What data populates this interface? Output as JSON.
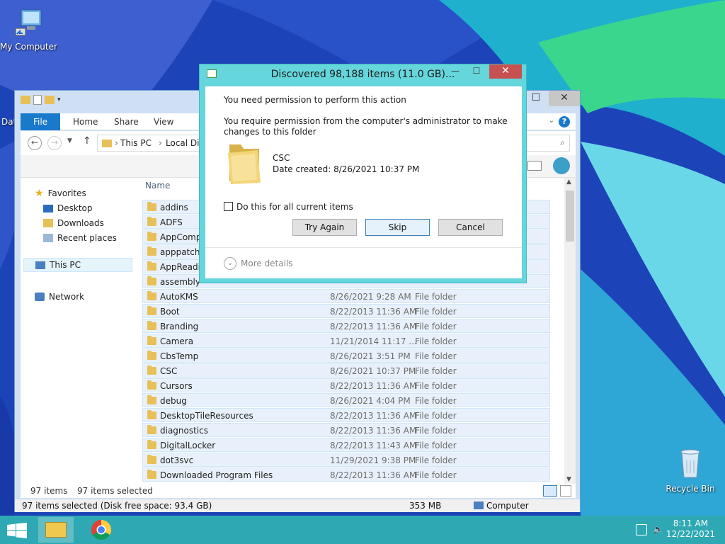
{
  "desktop": {
    "icons": [
      {
        "label": "My Computer"
      },
      {
        "label": "Dat"
      },
      {
        "label": "Recycle Bin"
      }
    ]
  },
  "explorer": {
    "ribbon_tabs": [
      "File",
      "Home",
      "Share",
      "View"
    ],
    "breadcrumb": [
      "This PC",
      "Local Di"
    ],
    "nav": {
      "favorites_label": "Favorites",
      "favorites": [
        "Desktop",
        "Downloads",
        "Recent places"
      ],
      "this_pc": "This PC",
      "network": "Network"
    },
    "column_name": "Name",
    "rows": [
      {
        "name": "addins",
        "date": "",
        "type": ""
      },
      {
        "name": "ADFS",
        "date": "",
        "type": ""
      },
      {
        "name": "AppComp",
        "date": "",
        "type": ""
      },
      {
        "name": "apppatch",
        "date": "",
        "type": ""
      },
      {
        "name": "AppReadin",
        "date": "",
        "type": ""
      },
      {
        "name": "assembly",
        "date": "",
        "type": ""
      },
      {
        "name": "AutoKMS",
        "date": "8/26/2021 9:28 AM",
        "type": "File folder"
      },
      {
        "name": "Boot",
        "date": "8/22/2013 11:36 AM",
        "type": "File folder"
      },
      {
        "name": "Branding",
        "date": "8/22/2013 11:36 AM",
        "type": "File folder"
      },
      {
        "name": "Camera",
        "date": "11/21/2014 11:17 ...",
        "type": "File folder"
      },
      {
        "name": "CbsTemp",
        "date": "8/26/2021 3:51 PM",
        "type": "File folder"
      },
      {
        "name": "CSC",
        "date": "8/26/2021 10:37 PM",
        "type": "File folder"
      },
      {
        "name": "Cursors",
        "date": "8/22/2013 11:36 AM",
        "type": "File folder"
      },
      {
        "name": "debug",
        "date": "8/26/2021 4:04 PM",
        "type": "File folder"
      },
      {
        "name": "DesktopTileResources",
        "date": "8/22/2013 11:36 AM",
        "type": "File folder"
      },
      {
        "name": "diagnostics",
        "date": "8/22/2013 11:36 AM",
        "type": "File folder"
      },
      {
        "name": "DigitalLocker",
        "date": "8/22/2013 11:43 AM",
        "type": "File folder"
      },
      {
        "name": "dot3svc",
        "date": "11/29/2021 9:38 PM",
        "type": "File folder"
      },
      {
        "name": "Downloaded Program Files",
        "date": "8/22/2013 11:36 AM",
        "type": "File folder"
      }
    ],
    "status_items": "97 items",
    "status_selected": "97 items selected",
    "details_left": "97 items selected (Disk free space: 93.4 GB)",
    "details_size": "353 MB",
    "details_location": "Computer"
  },
  "dialog": {
    "title": "Discovered 98,188 items (11.0 GB)...",
    "heading": "You need permission to perform this action",
    "message_line1": "You require permission from the computer's administrator to make",
    "message_line2": "changes to this folder",
    "folder_name": "CSC",
    "date_created": "Date created: 8/26/2021 10:37 PM",
    "checkbox_label": "Do this for all current items",
    "buttons": {
      "try_again": "Try Again",
      "skip": "Skip",
      "cancel": "Cancel"
    },
    "more_details": "More details"
  },
  "taskbar": {
    "time": "8:11 AM",
    "date": "12/22/2021"
  },
  "colors": {
    "taskbar": "#2ea9b3",
    "dialog_frame": "#65d6dc",
    "close_red": "#c75050",
    "file_tab": "#1979ca"
  }
}
